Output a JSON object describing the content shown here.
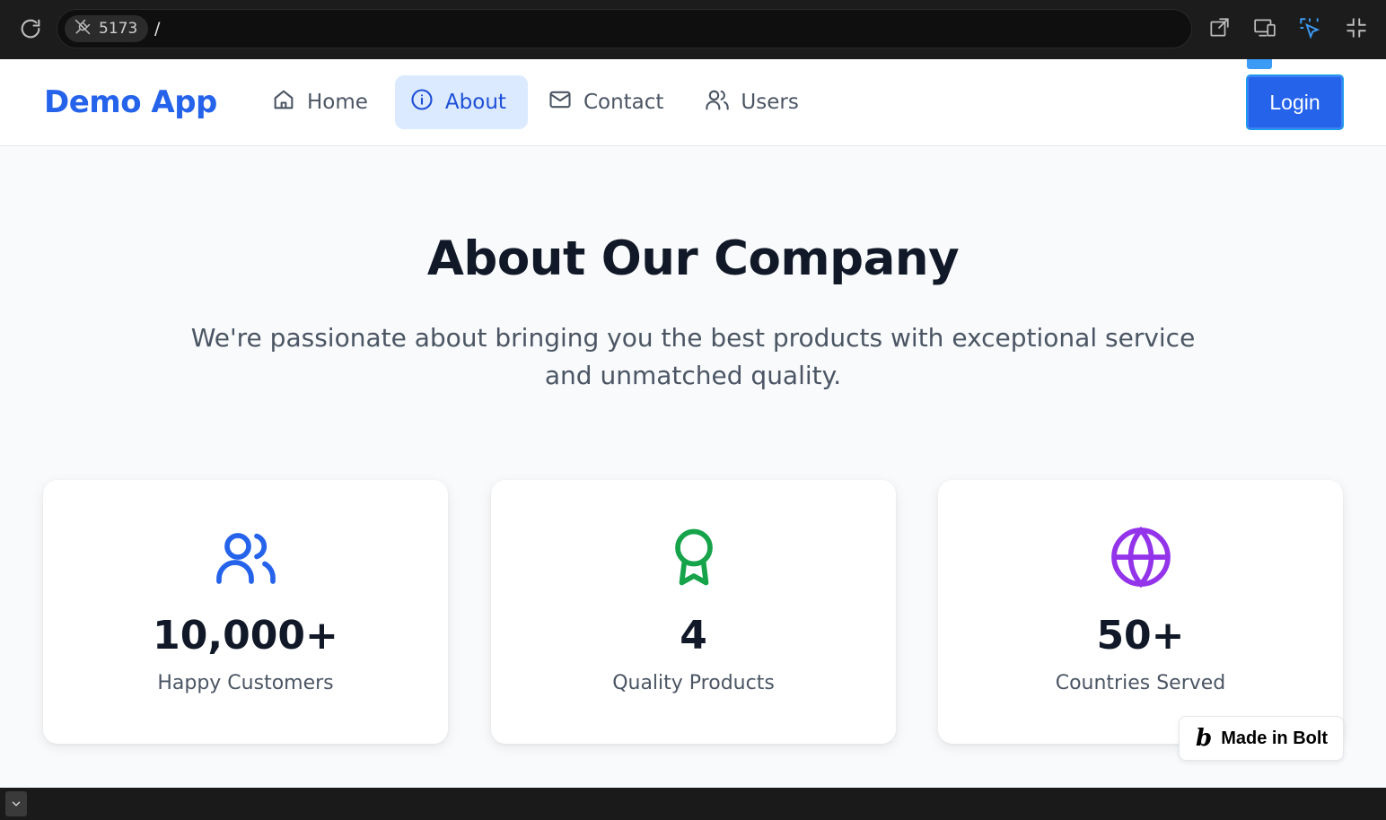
{
  "browser": {
    "port": "5173",
    "path": "/"
  },
  "app": {
    "brand": "Demo App",
    "accent": "#2563eb",
    "nav": [
      {
        "label": "Home",
        "icon": "home-icon",
        "active": false
      },
      {
        "label": "About",
        "icon": "info-icon",
        "active": true
      },
      {
        "label": "Contact",
        "icon": "mail-icon",
        "active": false
      },
      {
        "label": "Users",
        "icon": "users-icon",
        "active": false
      }
    ],
    "login_label": "Login"
  },
  "main": {
    "title": "About Our Company",
    "subtitle": "We're passionate about bringing you the best products with exceptional service and unmatched quality.",
    "stats": [
      {
        "value": "10,000+",
        "label": "Happy Customers",
        "icon": "users-icon",
        "color": "#2563eb"
      },
      {
        "value": "4",
        "label": "Quality Products",
        "icon": "award-icon",
        "color": "#16a34a"
      },
      {
        "value": "50+",
        "label": "Countries Served",
        "icon": "globe-icon",
        "color": "#9333ea"
      }
    ]
  },
  "badge": {
    "logo": "b",
    "label": "Made in Bolt"
  }
}
